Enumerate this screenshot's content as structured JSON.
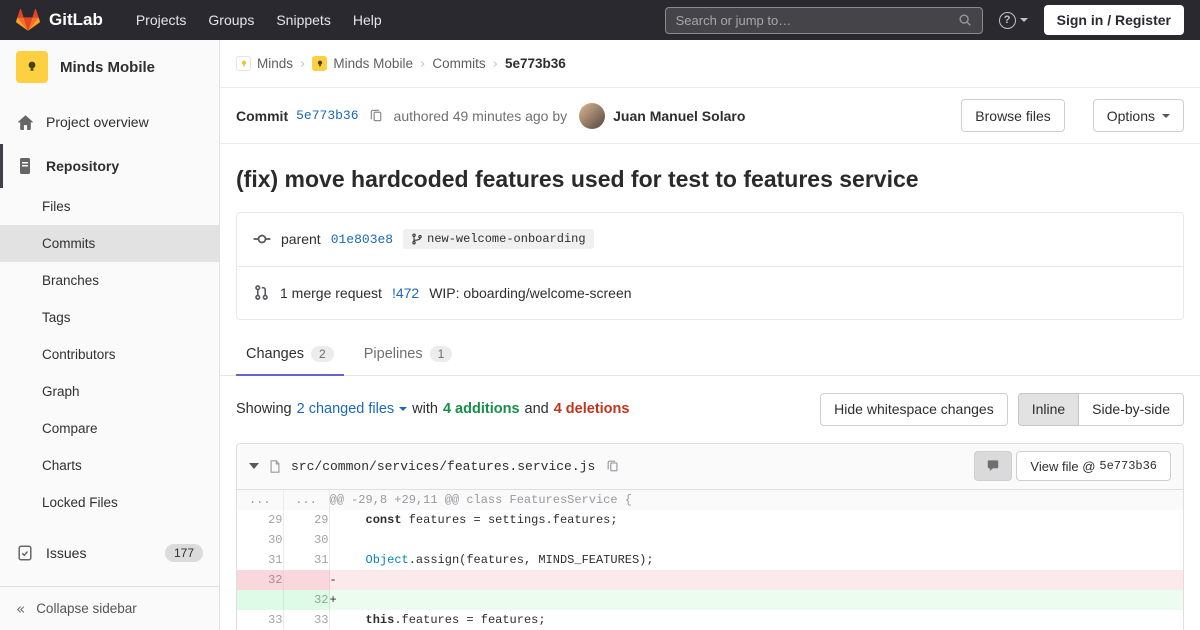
{
  "colors": {
    "navbar_bg": "#29292f",
    "link_blue": "#1b69b6",
    "addition_green": "#168f48",
    "deletion_red": "#c0341d",
    "active_tab_accent": "#6666c4",
    "brand_orange": "#fc6d26",
    "project_avatar_yellow": "#fcd040"
  },
  "navbar": {
    "brand": "GitLab",
    "menu": [
      "Projects",
      "Groups",
      "Snippets",
      "Help"
    ],
    "search_placeholder": "Search or jump to…",
    "sign_in_label": "Sign in / Register"
  },
  "sidebar": {
    "project_name": "Minds Mobile",
    "project_overview_label": "Project overview",
    "repository_label": "Repository",
    "repo_subitems": [
      {
        "label": "Files",
        "active": false
      },
      {
        "label": "Commits",
        "active": true
      },
      {
        "label": "Branches",
        "active": false
      },
      {
        "label": "Tags",
        "active": false
      },
      {
        "label": "Contributors",
        "active": false
      },
      {
        "label": "Graph",
        "active": false
      },
      {
        "label": "Compare",
        "active": false
      },
      {
        "label": "Charts",
        "active": false
      },
      {
        "label": "Locked Files",
        "active": false
      }
    ],
    "issues_label": "Issues",
    "issues_count": "177",
    "collapse_label": "Collapse sidebar",
    "collapse_glyph": "«"
  },
  "breadcrumb": {
    "group": "Minds",
    "project": "Minds Mobile",
    "section": "Commits",
    "current": "5e773b36",
    "separator": "›"
  },
  "commit_header": {
    "label": "Commit",
    "sha": "5e773b36",
    "authored_text": "authored 49 minutes ago by",
    "author": "Juan Manuel Solaro",
    "browse_files_label": "Browse files",
    "options_label": "Options"
  },
  "commit": {
    "title": "(fix) move hardcoded features used for test to features service",
    "parent_label": "parent",
    "parent_sha": "01e803e8",
    "branch": "new-welcome-onboarding",
    "mr_count_text": "1 merge request",
    "mr_ref": "!472",
    "mr_title": "WIP: oboarding/welcome-screen"
  },
  "tabs": {
    "changes_label": "Changes",
    "changes_count": "2",
    "pipelines_label": "Pipelines",
    "pipelines_count": "1"
  },
  "summary": {
    "showing": "Showing",
    "changed_files": "2 changed files",
    "with_text": "with",
    "additions": "4 additions",
    "and_text": "and",
    "deletions": "4 deletions",
    "hide_whitespace_label": "Hide whitespace changes",
    "inline_label": "Inline",
    "side_by_side_label": "Side-by-side"
  },
  "diff": {
    "file_path": "src/common/services/features.service.js",
    "view_file_label": "View file @",
    "view_file_sha": "5e773b36",
    "lines": [
      {
        "type": "hunk",
        "old": "...",
        "new": "...",
        "code": [
          {
            "t": "@@ -29,8 +29,11 @@ class FeaturesService {"
          }
        ]
      },
      {
        "type": "context",
        "old": "29",
        "new": "29",
        "code": [
          {
            "t": "     "
          },
          {
            "t": "const",
            "c": "k"
          },
          {
            "t": " features = settings.features;"
          }
        ]
      },
      {
        "type": "context",
        "old": "30",
        "new": "30",
        "code": [
          {
            "t": ""
          }
        ]
      },
      {
        "type": "context",
        "old": "31",
        "new": "31",
        "code": [
          {
            "t": "     "
          },
          {
            "t": "Object",
            "c": "nb"
          },
          {
            "t": ".assign(features, MINDS_FEATURES);"
          }
        ]
      },
      {
        "type": "del",
        "old": "32",
        "new": "",
        "code": [
          {
            "t": "-"
          }
        ]
      },
      {
        "type": "add",
        "old": "",
        "new": "32",
        "code": [
          {
            "t": "+"
          }
        ]
      },
      {
        "type": "context",
        "old": "33",
        "new": "33",
        "code": [
          {
            "t": "     "
          },
          {
            "t": "this",
            "c": "k"
          },
          {
            "t": ".features = features;"
          }
        ]
      }
    ]
  }
}
